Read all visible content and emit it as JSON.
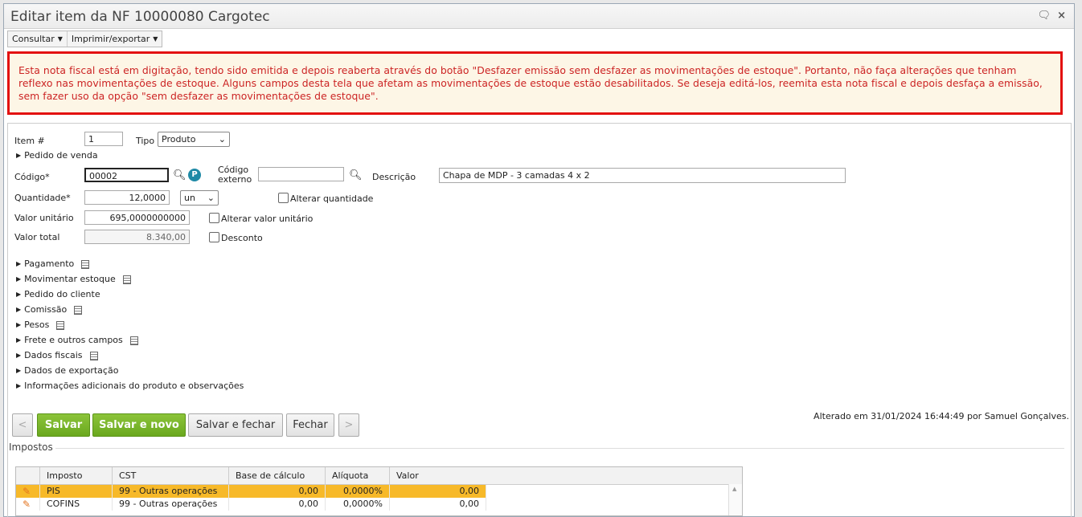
{
  "window": {
    "title": "Editar item da NF 10000080 Cargotec"
  },
  "menus": [
    {
      "label": "Consultar"
    },
    {
      "label": "Imprimir/exportar"
    }
  ],
  "alert": {
    "text": "Esta nota fiscal está em digitação, tendo sido emitida e depois reaberta através do botão \"Desfazer emissão sem desfazer as movimentações de estoque\". Portanto, não faça alterações que tenham reflexo nas movimentações de estoque. Alguns campos desta tela que afetam as movimentações de estoque estão desabilitados. Se deseja editá-los, reemita esta nota fiscal e depois desfaça a emissão, sem fazer uso da opção \"sem desfazer as movimentações de estoque\"."
  },
  "form": {
    "item_label": "Item #",
    "item_value": "1",
    "tipo_label": "Tipo",
    "tipo_value": "Produto",
    "pedido_venda": "Pedido de venda",
    "codigo_label": "Código*",
    "codigo_value": "00002",
    "codigo_externo_label": "Código externo",
    "codigo_externo_value": "",
    "descricao_label": "Descrição",
    "descricao_value": "Chapa de MDP - 3 camadas 4 x 2",
    "quantidade_label": "Quantidade*",
    "quantidade_value": "12,0000",
    "unidade_value": "un",
    "alterar_quantidade": "Alterar quantidade",
    "valor_unitario_label": "Valor unitário",
    "valor_unitario_value": "695,0000000000",
    "alterar_valor_unitario": "Alterar valor unitário",
    "valor_total_label": "Valor total",
    "valor_total_value": "8.340,00",
    "desconto": "Desconto"
  },
  "sections": [
    {
      "label": "Pagamento",
      "doc": true
    },
    {
      "label": "Movimentar estoque",
      "doc": true
    },
    {
      "label": "Pedido do cliente",
      "doc": false
    },
    {
      "label": "Comissão",
      "doc": true
    },
    {
      "label": "Pesos",
      "doc": true
    },
    {
      "label": "Frete e outros campos",
      "doc": true
    },
    {
      "label": "Dados fiscais",
      "doc": true
    },
    {
      "label": "Dados de exportação",
      "doc": false
    },
    {
      "label": "Informações adicionais do produto e observações",
      "doc": false
    }
  ],
  "buttons": {
    "prev": "<",
    "salvar": "Salvar",
    "salvar_novo": "Salvar e novo",
    "salvar_fechar": "Salvar e fechar",
    "fechar": "Fechar",
    "next": ">"
  },
  "altered": "Alterado em 31/01/2024 16:44:49 por Samuel Gonçalves.",
  "impostos": {
    "title": "Impostos",
    "columns": [
      "Imposto",
      "CST",
      "Base de cálculo",
      "Alíquota",
      "Valor"
    ],
    "rows": [
      [
        "PIS",
        "99 - Outras operações",
        "0,00",
        "0,0000%",
        "0,00"
      ],
      [
        "COFINS",
        "99 - Outras operações",
        "0,00",
        "0,0000%",
        "0,00"
      ]
    ]
  },
  "colors": {
    "alert_border": "#e31010",
    "alert_text": "#cc2424",
    "alert_bg": "#fdf6e6",
    "primary_button": "#7ab72c",
    "selected_row": "#f7b929"
  }
}
